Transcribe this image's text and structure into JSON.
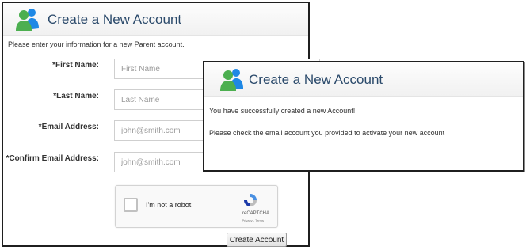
{
  "registration_form": {
    "title": "Create a New Account",
    "intro": "Please enter your information for a new Parent account.",
    "fields": [
      {
        "label": "*First Name:",
        "placeholder": "First Name"
      },
      {
        "label": "*Last Name:",
        "placeholder": "Last Name"
      },
      {
        "label": "*Email Address:",
        "placeholder": "john@smith.com"
      },
      {
        "label": "*Confirm Email Address:",
        "placeholder": "john@smith.com"
      }
    ],
    "recaptcha": {
      "checkbox_label": "I'm not a robot",
      "brand": "reCAPTCHA",
      "links": "Privacy - Terms"
    },
    "submit_label": "Create Account"
  },
  "success_dialog": {
    "title": "Create a New Account",
    "line1": "You have successfully created a new Account!",
    "line2": "Please check the email account you provided to activate your new account"
  },
  "colors": {
    "title_text": "#2b4a6b",
    "logo_green": "#4caf50",
    "logo_blue": "#1e88e5"
  },
  "icons": {
    "logo": "users-icon",
    "captcha_logo": "recaptcha-icon"
  }
}
